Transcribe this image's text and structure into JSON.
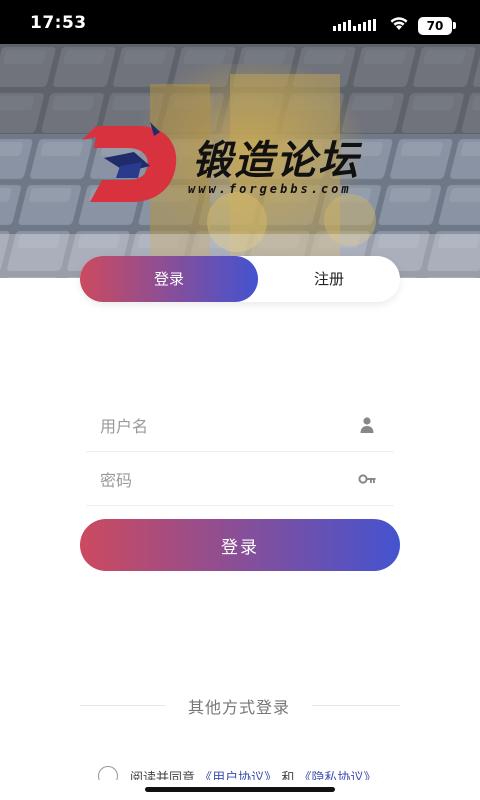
{
  "status_bar": {
    "time": "17:53",
    "battery": "70",
    "icons": [
      "signal-icon",
      "wifi-icon",
      "battery-icon"
    ]
  },
  "logo": {
    "title": "锻造论坛",
    "url": "www.forgebbs.com"
  },
  "tabs": [
    {
      "label": "登录",
      "active": true
    },
    {
      "label": "注册",
      "active": false
    }
  ],
  "form": {
    "username_placeholder": "用户名",
    "username_value": "",
    "password_placeholder": "密码",
    "password_value": ""
  },
  "login_button": "登录",
  "other_login": "其他方式登录",
  "agreement": {
    "prefix": "阅读并同意",
    "user_agreement": "《用户协议》",
    "and": "和",
    "privacy_policy": "《隐私协议》"
  },
  "colors": {
    "gradient_start": "#cc4a5f",
    "gradient_end": "#4453d0",
    "logo_red": "#d8323f",
    "link": "#3d4fb0"
  }
}
